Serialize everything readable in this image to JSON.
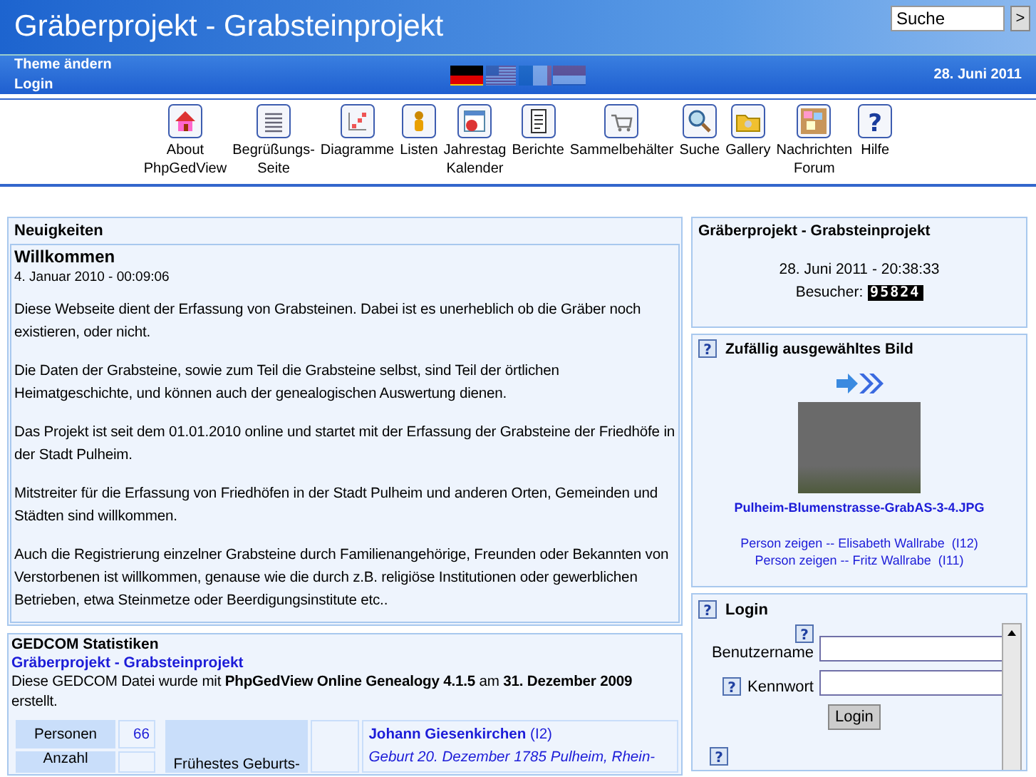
{
  "header": {
    "title": "Gräberprojekt - Grabsteinprojekt",
    "search": {
      "value": "Suche"
    },
    "search_button": ">",
    "links": [
      "Theme ändern",
      "Login"
    ],
    "date": "28. Juni 2011",
    "languages": [
      {
        "kind": "de",
        "selected": true
      },
      {
        "kind": "us",
        "selected": false
      },
      {
        "kind": "fr",
        "selected": false
      },
      {
        "kind": "nl",
        "selected": false
      }
    ]
  },
  "menu": [
    {
      "kind": "home",
      "lines": [
        "About",
        "PhpGedView"
      ]
    },
    {
      "kind": "list",
      "lines": [
        "Begrüßungs-",
        "Seite"
      ]
    },
    {
      "kind": "chart",
      "lines": [
        "Diagramme"
      ]
    },
    {
      "kind": "person",
      "lines": [
        "Listen"
      ]
    },
    {
      "kind": "calendar",
      "lines": [
        "Jahrestag",
        "Kalender"
      ]
    },
    {
      "kind": "report",
      "lines": [
        "Berichte"
      ]
    },
    {
      "kind": "cart",
      "lines": [
        "Sammelbehälter"
      ]
    },
    {
      "kind": "search",
      "lines": [
        "Suche"
      ]
    },
    {
      "kind": "folder",
      "lines": [
        "Gallery"
      ]
    },
    {
      "kind": "board",
      "lines": [
        "Nachrichten",
        "Forum"
      ]
    },
    {
      "kind": "help",
      "glyph": "?",
      "lines": [
        "Hilfe"
      ]
    }
  ],
  "news": {
    "heading": "Neuigkeiten",
    "title": "Willkommen",
    "date": "4. Januar 2010 - 00:09:06",
    "paragraphs": [
      "Diese Webseite dient der Erfassung von Grabsteinen. Dabei ist es unerheblich ob die Gräber noch existieren, oder nicht.",
      "Die Daten der Grabsteine, sowie zum Teil die Grabsteine selbst, sind Teil der örtlichen Heimatgeschichte, und können auch der genealogischen Auswertung dienen.",
      "Das Projekt ist seit dem 01.01.2010 online und startet mit der Erfassung der Grabsteine der Friedhöfe in der Stadt Pulheim.",
      "Mitstreiter für die Erfassung von Friedhöfen in der Stadt Pulheim und anderen Orten, Gemeinden und Städten sind willkommen.",
      "Auch die Registrierung einzelner Grabsteine durch Familienangehörige, Freunden oder Bekannten von Verstorbenen ist willkommen, genause wie die durch z.B. religiöse Institutionen oder gewerblichen Betrieben, etwa Steinmetze oder Beerdigungsinstitute etc.."
    ]
  },
  "stats": {
    "heading": "GEDCOM Statistiken",
    "site_link": "Gräberprojekt - Grabsteinprojekt",
    "summary": "Diese GEDCOM Datei wurde mit **PhpGedView Online Genealogy 4.1.5** am **31. Dezember 2009** erstellt.",
    "counts": [
      {
        "label": "Personen",
        "value": "66"
      },
      {
        "label": "Anzahl"
      }
    ],
    "earliest": {
      "label": "Frühestes Geburts-",
      "person": "Johann Giesenkirchen",
      "id": "(I2)",
      "detail": "Geburt 20. Dezember 1785 Pulheim, Rhein-"
    }
  },
  "info": {
    "heading": "Gräberprojekt - Grabsteinprojekt",
    "datetime": "28. Juni 2011 - 20:38:33",
    "visitors_label": "Besucher:",
    "visitors": "95824"
  },
  "random_image": {
    "help_icon": "?",
    "heading": "Zufällig ausgewähltes Bild",
    "file": "Pulheim-Blumenstrasse-GrabAS-3-4.JPG",
    "people": [
      "Person zeigen -- Elisabeth Wallrabe  (I12)",
      "Person zeigen -- Fritz Wallrabe  (I11)"
    ]
  },
  "login": {
    "help_icon": "?",
    "heading": "Login",
    "fields": [
      {
        "help_icon": "?",
        "label": "Benutzername"
      },
      {
        "help_icon": "?",
        "label": "Kennwort"
      }
    ],
    "button": "Login",
    "more_help_icon": "?"
  }
}
